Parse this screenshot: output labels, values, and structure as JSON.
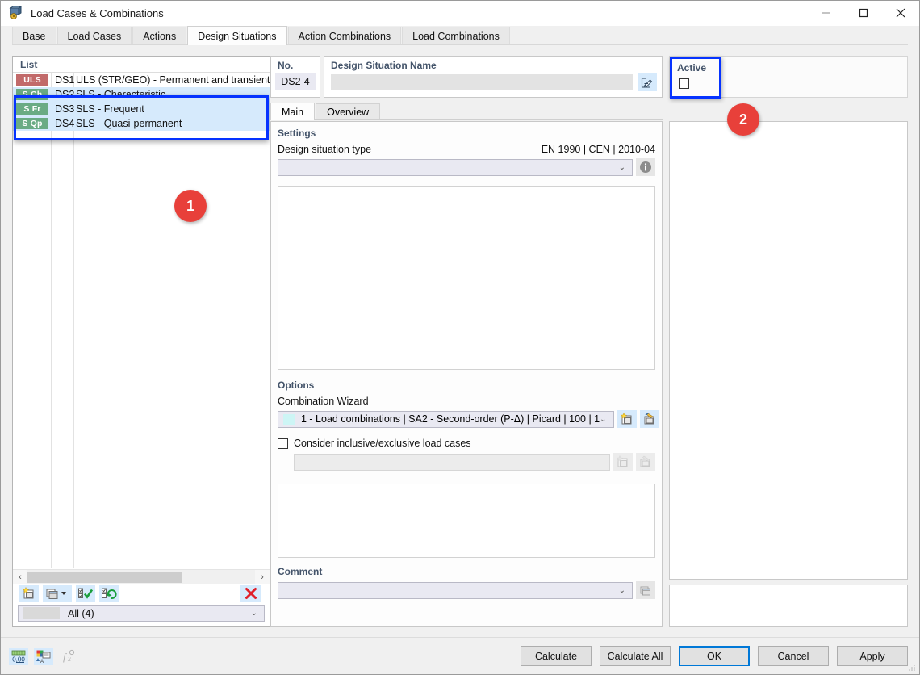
{
  "window": {
    "title": "Load Cases & Combinations",
    "icon": "load-cases-icon",
    "minimize": "—",
    "maximize": "☐",
    "close": "✕"
  },
  "tabs": [
    {
      "label": "Base",
      "active": false
    },
    {
      "label": "Load Cases",
      "active": false
    },
    {
      "label": "Actions",
      "active": false
    },
    {
      "label": "Design Situations",
      "active": true
    },
    {
      "label": "Action Combinations",
      "active": false
    },
    {
      "label": "Load Combinations",
      "active": false
    }
  ],
  "list": {
    "header": "List",
    "rows": [
      {
        "badge": "ULS",
        "badge_type": "uls",
        "no": "DS1",
        "description": "ULS (STR/GEO) - Permanent and transient - E",
        "selected": false
      },
      {
        "badge": "S Ch",
        "badge_type": "sls",
        "no": "DS2",
        "description": "SLS - Characteristic",
        "selected": true
      },
      {
        "badge": "S Fr",
        "badge_type": "sls",
        "no": "DS3",
        "description": "SLS - Frequent",
        "selected": true
      },
      {
        "badge": "S Qp",
        "badge_type": "sls",
        "no": "DS4",
        "description": "SLS - Quasi-permanent",
        "selected": true
      }
    ],
    "scroll_left": "‹",
    "scroll_right": "›",
    "toolbar": [
      {
        "name": "new-design-situation-button",
        "icon": "new-item-icon"
      },
      {
        "name": "copy-design-situation-button",
        "icon": "copy-item-icon"
      },
      {
        "name": "select-all-button",
        "icon": "check-all-icon"
      },
      {
        "name": "invert-selection-button",
        "icon": "toggle-selection-icon"
      },
      {
        "name": "delete-button",
        "icon": "red-x-icon"
      }
    ],
    "delete_glyph": "✕",
    "filter": {
      "label": "All (4)",
      "arrow": "⌄"
    }
  },
  "callouts": [
    {
      "number": "1"
    },
    {
      "number": "2"
    }
  ],
  "details": {
    "no_label": "No.",
    "no_value": "DS2-4",
    "name_label": "Design Situation Name",
    "name_value": "",
    "name_placeholder": "",
    "edit_icon": "edit-pencil-icon",
    "subtabs": [
      {
        "label": "Main",
        "active": true
      },
      {
        "label": "Overview",
        "active": false
      }
    ],
    "settings": {
      "group_label": "Settings",
      "type_label": "Design situation type",
      "standard_note": "EN 1990 | CEN | 2010-04",
      "type_value": "",
      "combo_arrow": "⌄",
      "info_icon": "info-icon",
      "info_glyph": "i"
    },
    "options": {
      "group_label": "Options",
      "wizard_label": "Combination Wizard",
      "wizard_value": "1 - Load combinations | SA2 - Second-order (P-Δ) | Picard | 100 | 1",
      "wizard_swatch": "#cdf5f5",
      "combo_arrow": "⌄",
      "new_wizard_icon": "new-wizard-icon",
      "edit_wizard_icon": "edit-wizard-icon",
      "checkbox_label": "Consider inclusive/exclusive load cases",
      "checkbox_checked": false,
      "secondary_value": "",
      "secondary_new_icon": "new-item-icon-disabled",
      "secondary_edit_icon": "edit-item-icon-disabled"
    },
    "comment": {
      "group_label": "Comment",
      "value": "",
      "combo_arrow": "⌄",
      "pick_icon": "comment-pick-icon"
    }
  },
  "active_panel": {
    "label": "Active",
    "checked": false
  },
  "footer": {
    "icons": [
      {
        "name": "number-format-icon",
        "label": "0,00",
        "disabled": false
      },
      {
        "name": "display-properties-icon",
        "label": "",
        "disabled": false
      },
      {
        "name": "formula-icon",
        "label": "f",
        "disabled": true
      }
    ],
    "buttons": [
      {
        "label": "Calculate",
        "primary": false
      },
      {
        "label": "Calculate All",
        "primary": false
      },
      {
        "label": "OK",
        "primary": true
      },
      {
        "label": "Cancel",
        "primary": false
      },
      {
        "label": "Apply",
        "primary": false
      }
    ]
  },
  "colors": {
    "accent_blue": "#0078d7",
    "highlight_outline": "#0633ff",
    "selection_bg": "#d6eafc",
    "callout_red": "#e8403a",
    "uls_badge": "#c26a6a",
    "sls_badge": "#6aab84",
    "group_label": "#44546a"
  }
}
